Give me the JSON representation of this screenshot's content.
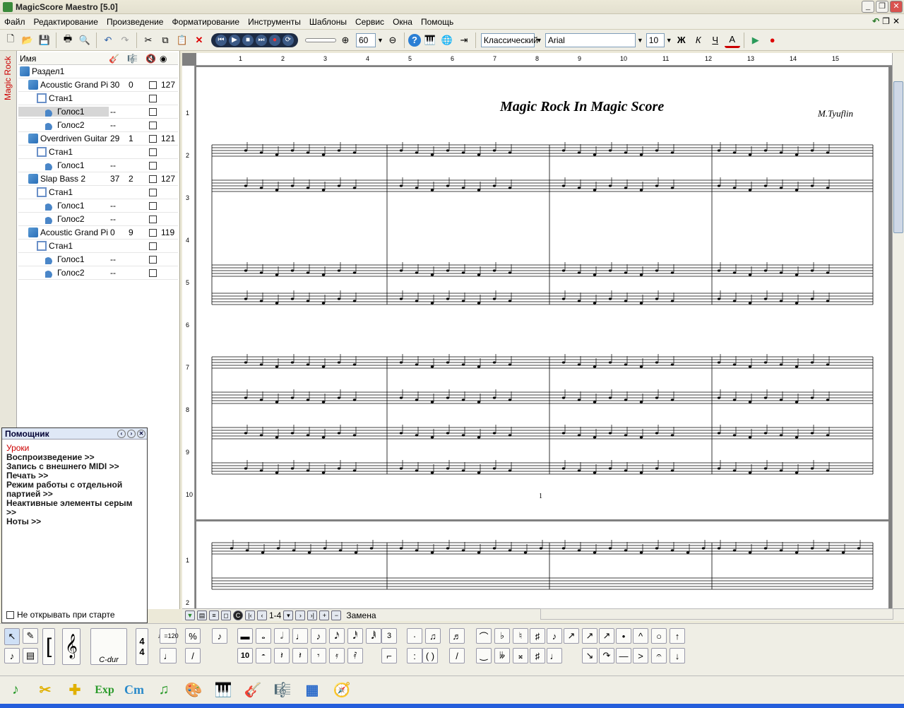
{
  "window": {
    "title": "MagicScore Maestro [5.0]"
  },
  "menu": [
    "Файл",
    "Редактирование",
    "Произведение",
    "Форматирование",
    "Инструменты",
    "Шаблоны",
    "Сервис",
    "Окна",
    "Помощь"
  ],
  "toolbar": {
    "zoom": "60",
    "style": "Классический",
    "font": "Arial",
    "font_size": "10",
    "format_buttons": [
      "Ж",
      "К",
      "Ч",
      "А"
    ]
  },
  "left_panel": {
    "vertical_tab": "Magic Rock",
    "header": {
      "name": "Имя"
    },
    "rows": [
      {
        "name": "Раздел1",
        "c1": "",
        "c2": "",
        "check": false,
        "c4": "",
        "type": "section"
      },
      {
        "name": "Acoustic Grand Pi...",
        "c1": "30",
        "c2": "0",
        "check": true,
        "c4": "127",
        "type": "instrument"
      },
      {
        "name": "Стан1",
        "c1": "",
        "c2": "",
        "check": true,
        "c4": "",
        "type": "staff"
      },
      {
        "name": "Голос1",
        "c1": "--",
        "c2": "",
        "check": true,
        "c4": "",
        "type": "voice",
        "selected": true
      },
      {
        "name": "Голос2",
        "c1": "--",
        "c2": "",
        "check": true,
        "c4": "",
        "type": "voice"
      },
      {
        "name": "Overdriven Guitar",
        "c1": "29",
        "c2": "1",
        "check": true,
        "c4": "121",
        "type": "instrument"
      },
      {
        "name": "Стан1",
        "c1": "",
        "c2": "",
        "check": true,
        "c4": "",
        "type": "staff"
      },
      {
        "name": "Голос1",
        "c1": "--",
        "c2": "",
        "check": true,
        "c4": "",
        "type": "voice"
      },
      {
        "name": "Slap Bass 2",
        "c1": "37",
        "c2": "2",
        "check": true,
        "c4": "127",
        "type": "instrument"
      },
      {
        "name": "Стан1",
        "c1": "",
        "c2": "",
        "check": true,
        "c4": "",
        "type": "staff"
      },
      {
        "name": "Голос1",
        "c1": "--",
        "c2": "",
        "check": true,
        "c4": "",
        "type": "voice"
      },
      {
        "name": "Голос2",
        "c1": "--",
        "c2": "",
        "check": true,
        "c4": "",
        "type": "voice"
      },
      {
        "name": "Acoustic Grand Pi...",
        "c1": "0",
        "c2": "9",
        "check": true,
        "c4": "119",
        "type": "instrument"
      },
      {
        "name": "Стан1",
        "c1": "",
        "c2": "",
        "check": true,
        "c4": "",
        "type": "staff"
      },
      {
        "name": "Голос1",
        "c1": "--",
        "c2": "",
        "check": true,
        "c4": "",
        "type": "voice"
      },
      {
        "name": "Голос2",
        "c1": "--",
        "c2": "",
        "check": true,
        "c4": "",
        "type": "voice"
      }
    ]
  },
  "helper": {
    "title": "Помощник",
    "lessons": "Уроки",
    "links": [
      "Воспроизведение >>",
      "Запись с внешнего MIDI >>",
      "Печать >>",
      "Режим работы с отдельной партией >>",
      "Неактивные элементы серым >>",
      "Ноты >>"
    ],
    "dont_open": "Не открывать при старте"
  },
  "score": {
    "title": "Magic Rock In Magic Score",
    "composer": "M.Tyuflin",
    "page_number": "1",
    "ruler": [
      "1",
      "2",
      "3",
      "4",
      "5",
      "6",
      "7",
      "8",
      "9",
      "10",
      "11",
      "12",
      "13",
      "14",
      "15"
    ],
    "vruler": [
      "1",
      "2",
      "3",
      "4",
      "5",
      "6",
      "7",
      "8",
      "9",
      "10",
      "1",
      "2"
    ]
  },
  "status": {
    "range": "1-4",
    "mode": "Замена"
  },
  "palette": {
    "tempo": "♩=120",
    "key": "C-dur",
    "tuplet": "3"
  },
  "bigtools": [
    "Exp",
    "Cm"
  ]
}
